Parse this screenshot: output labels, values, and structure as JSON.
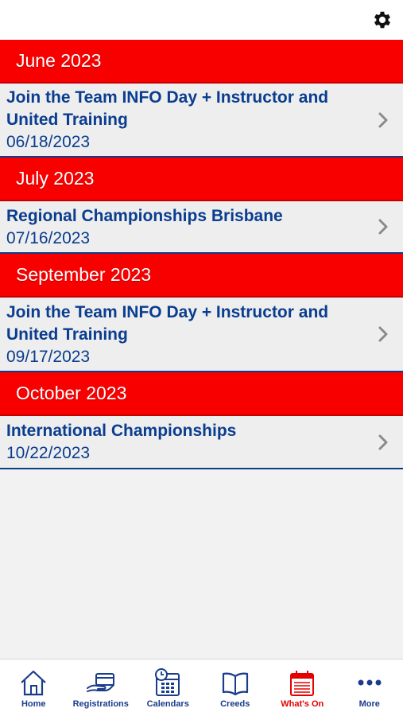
{
  "header": {
    "settings_icon": "gear-icon"
  },
  "colors": {
    "section_red": "#f80000",
    "text_blue": "#0a3d8f",
    "active_red": "#e50000"
  },
  "sections": [
    {
      "month": "June 2023",
      "events": [
        {
          "title": "Join the Team INFO Day + Instructor and United Training",
          "date": "06/18/2023"
        }
      ]
    },
    {
      "month": "July 2023",
      "events": [
        {
          "title": "Regional Championships Brisbane",
          "date": "07/16/2023"
        }
      ]
    },
    {
      "month": "September 2023",
      "events": [
        {
          "title": "Join the Team INFO Day + Instructor and United Training",
          "date": "09/17/2023"
        }
      ]
    },
    {
      "month": "October 2023",
      "events": [
        {
          "title": "International Championships",
          "date": "10/22/2023"
        }
      ]
    }
  ],
  "tabbar": {
    "tabs": [
      {
        "label": "Home",
        "icon": "house-icon"
      },
      {
        "label": "Registrations",
        "icon": "hand-card-icon"
      },
      {
        "label": "Calendars",
        "icon": "calendar-clock-icon"
      },
      {
        "label": "Creeds",
        "icon": "open-book-icon"
      },
      {
        "label": "What's On",
        "icon": "calendar-list-icon",
        "active": true
      },
      {
        "label": "More",
        "icon": "more-dots-icon"
      }
    ]
  }
}
